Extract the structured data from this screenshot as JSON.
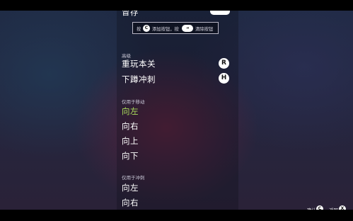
{
  "menu": {
    "partial_top_label": "冒存",
    "hint": {
      "press": "按",
      "add_key_icon": "C",
      "add_text": "添加按钮，按",
      "clear_key_icon": "⇥",
      "clear_text": "清除按钮"
    },
    "advanced": {
      "header": "高级",
      "items": [
        {
          "label": "重玩本关",
          "key": "R"
        },
        {
          "label": "下蹲冲刺",
          "key": "H"
        }
      ]
    },
    "move_only": {
      "header": "仅用于移动",
      "items": [
        {
          "label": "向左",
          "selected": true
        },
        {
          "label": "向右"
        },
        {
          "label": "向上"
        },
        {
          "label": "向下"
        }
      ]
    },
    "dash_only": {
      "header": "仅用于冲刺",
      "items": [
        {
          "label": "向左"
        },
        {
          "label": "向右"
        }
      ]
    }
  },
  "footer": {
    "confirm_label": "确认",
    "confirm_key": "C",
    "back_label": "返回",
    "back_key": "X"
  },
  "colors": {
    "selected": "#a9dc5a",
    "text": "#ffffff"
  }
}
